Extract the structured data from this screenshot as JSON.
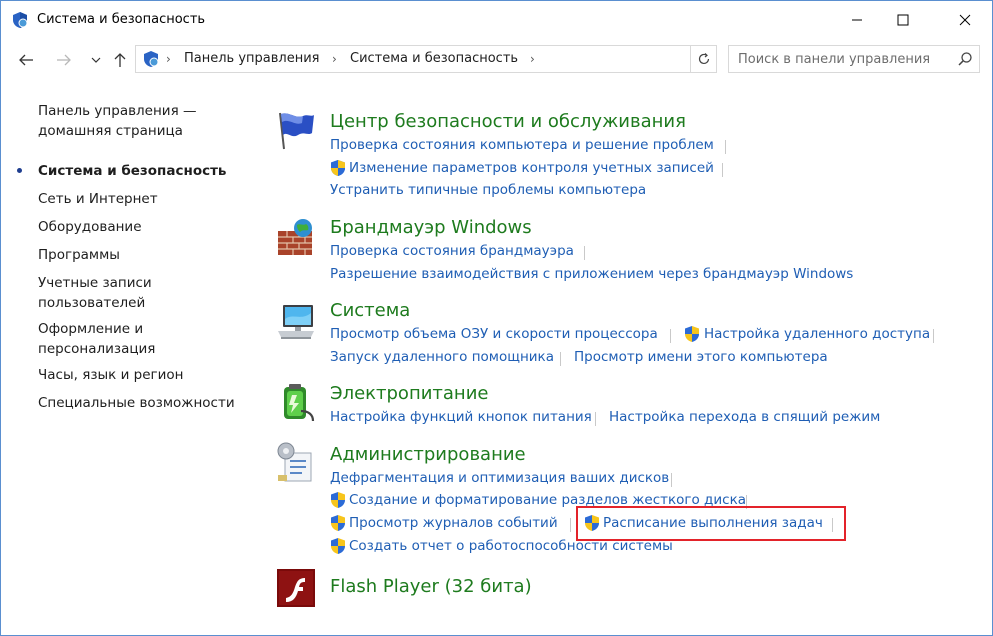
{
  "window": {
    "title": "Система и безопасность",
    "min_glyph": "─",
    "max_glyph": "☐",
    "close_glyph": "✕"
  },
  "address": {
    "sep": "›",
    "crumbs": [
      "Панель управления",
      "Система и безопасность"
    ]
  },
  "search": {
    "placeholder": "Поиск в панели управления"
  },
  "sidebar": {
    "home_line1": "Панель управления —",
    "home_line2": "домашняя страница",
    "current": "Система и безопасность",
    "items": [
      "Сеть и Интернет",
      "Оборудование",
      "Программы",
      [
        "Учетные записи",
        "пользователей"
      ],
      [
        "Оформление и",
        "персонализация"
      ],
      "Часы, язык и регион",
      "Специальные возможности"
    ]
  },
  "sections": {
    "security": {
      "title": "Центр безопасности и обслуживания",
      "links": [
        "Проверка состояния компьютера и решение проблем",
        "Изменение параметров контроля учетных записей",
        "Устранить типичные проблемы компьютера"
      ]
    },
    "firewall": {
      "title": "Брандмауэр Windows",
      "links": [
        "Проверка состояния брандмауэра",
        "Разрешение взаимодействия с приложением через брандмауэр Windows"
      ]
    },
    "system": {
      "title": "Система",
      "links": [
        "Просмотр объема ОЗУ и скорости процессора",
        "Настройка удаленного доступа",
        "Запуск удаленного помощника",
        "Просмотр имени этого компьютера"
      ]
    },
    "power": {
      "title": "Электропитание",
      "links": [
        "Настройка функций кнопок питания",
        "Настройка перехода в спящий режим"
      ]
    },
    "admin": {
      "title": "Администрирование",
      "links": [
        "Дефрагментация и оптимизация ваших дисков",
        "Создание и форматирование разделов жесткого диска",
        "Просмотр журналов событий",
        "Расписание выполнения задач",
        "Создать отчет о работоспособности системы"
      ]
    },
    "flash": {
      "title": "Flash Player (32 бита)"
    }
  },
  "colors": {
    "title_green": "#1e7b1e",
    "link_blue": "#1f5eb4",
    "highlight_red": "#e3232a"
  }
}
